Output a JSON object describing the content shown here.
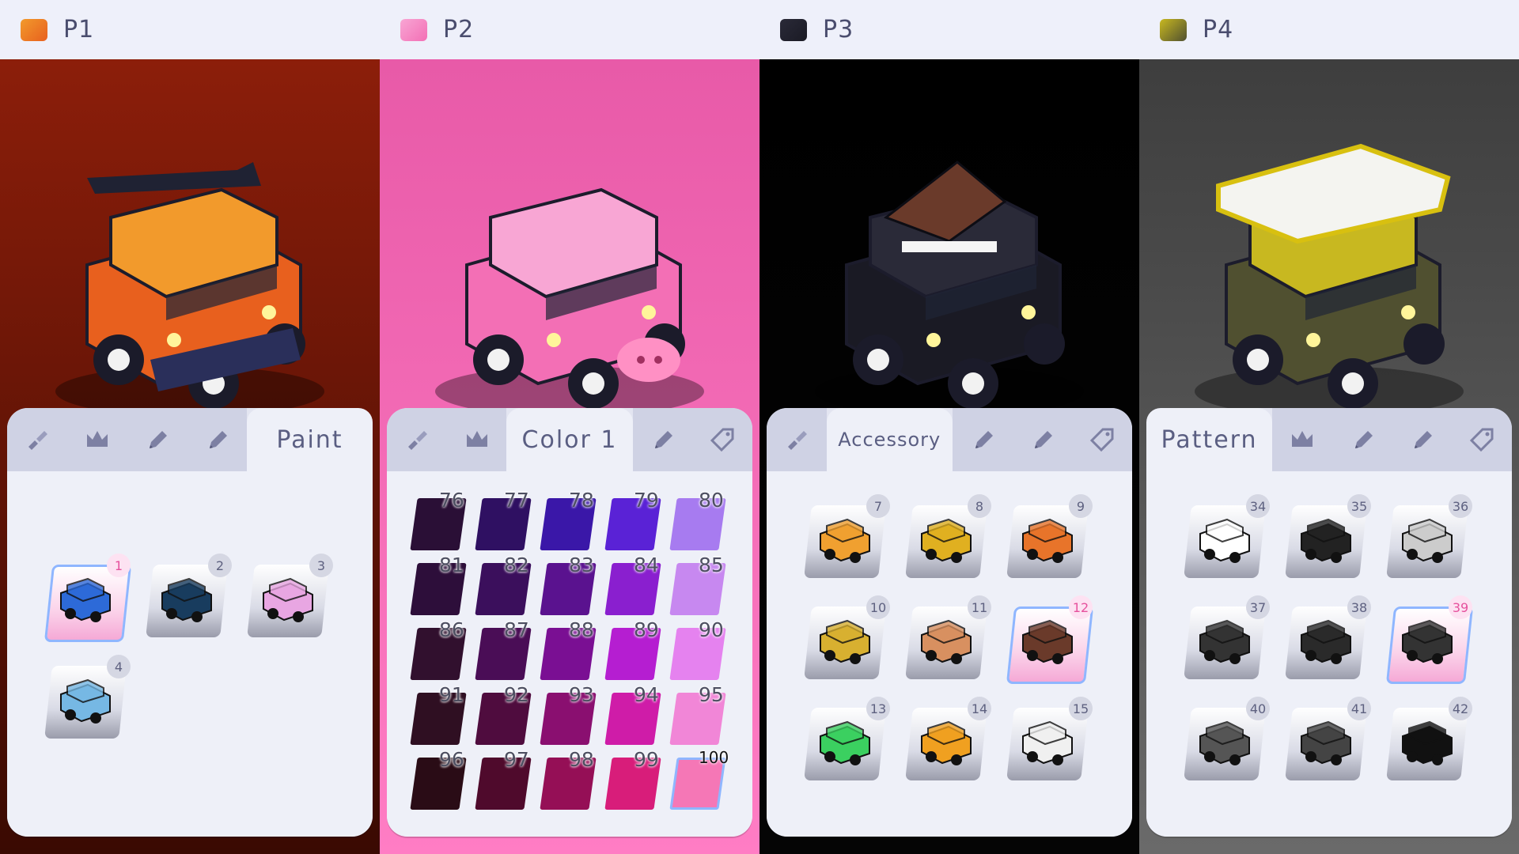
{
  "panels": [
    {
      "player": "P1",
      "bg_top": "#8c1e0a",
      "bg_bottom": "#3a0a02",
      "tabs": [
        {
          "icon": "brush-icon",
          "label": ""
        },
        {
          "icon": "crown-icon",
          "label": ""
        },
        {
          "icon": "pen-icon",
          "label": ""
        },
        {
          "icon": "pen-icon",
          "label": ""
        },
        {
          "icon": "",
          "label": "Paint",
          "active": true
        }
      ],
      "items": [
        {
          "num": "1",
          "selected": true,
          "color": "#2d6ad8"
        },
        {
          "num": "2",
          "selected": false,
          "color": "#183c5e"
        },
        {
          "num": "3",
          "selected": false,
          "color": "#e8a6e2"
        },
        {
          "num": "4",
          "selected": false,
          "color": "#76b8e4"
        }
      ]
    },
    {
      "player": "P2",
      "bg_top": "#e85aa8",
      "bg_bottom": "#ff7dc4",
      "tabs": [
        {
          "icon": "brush-icon",
          "label": ""
        },
        {
          "icon": "crown-icon",
          "label": ""
        },
        {
          "icon": "",
          "label": "Color 1",
          "active": true
        },
        {
          "icon": "pen-icon",
          "label": ""
        },
        {
          "icon": "tag-icon",
          "label": ""
        }
      ],
      "swatches": [
        {
          "num": "76",
          "color": "#2a0f36"
        },
        {
          "num": "77",
          "color": "#2f1062"
        },
        {
          "num": "78",
          "color": "#3a17a8"
        },
        {
          "num": "79",
          "color": "#5a22d6"
        },
        {
          "num": "80",
          "color": "#a77bf0"
        },
        {
          "num": "81",
          "color": "#2d0e3a"
        },
        {
          "num": "82",
          "color": "#3b0f5c"
        },
        {
          "num": "83",
          "color": "#5a128f"
        },
        {
          "num": "84",
          "color": "#8a1fcf"
        },
        {
          "num": "85",
          "color": "#c788f0"
        },
        {
          "num": "86",
          "color": "#31102e"
        },
        {
          "num": "87",
          "color": "#4a0d56"
        },
        {
          "num": "88",
          "color": "#7a0f93"
        },
        {
          "num": "89",
          "color": "#b51ed1"
        },
        {
          "num": "90",
          "color": "#e582ef"
        },
        {
          "num": "91",
          "color": "#2f0f22"
        },
        {
          "num": "92",
          "color": "#4f0c3e"
        },
        {
          "num": "93",
          "color": "#8a0f70"
        },
        {
          "num": "94",
          "color": "#cf1ca8"
        },
        {
          "num": "95",
          "color": "#f186d7"
        },
        {
          "num": "96",
          "color": "#2a0c16"
        },
        {
          "num": "97",
          "color": "#4f0a2c"
        },
        {
          "num": "98",
          "color": "#950f56"
        },
        {
          "num": "99",
          "color": "#d81d7a"
        },
        {
          "num": "100",
          "color": "#f577b6",
          "selected": true
        }
      ]
    },
    {
      "player": "P3",
      "bg_top": "#000000",
      "bg_bottom": "#050505",
      "tabs": [
        {
          "icon": "brush-icon",
          "label": ""
        },
        {
          "icon": "",
          "label": "Accessory",
          "active": true,
          "small": true
        },
        {
          "icon": "pen-icon",
          "label": ""
        },
        {
          "icon": "pen-icon",
          "label": ""
        },
        {
          "icon": "tag-icon",
          "label": ""
        }
      ],
      "items": [
        {
          "num": "7",
          "selected": false,
          "color": "#f0a030"
        },
        {
          "num": "8",
          "selected": false,
          "color": "#e0b020"
        },
        {
          "num": "9",
          "selected": false,
          "color": "#e8742a"
        },
        {
          "num": "10",
          "selected": false,
          "color": "#d8b030"
        },
        {
          "num": "11",
          "selected": false,
          "color": "#d89060"
        },
        {
          "num": "12",
          "selected": true,
          "color": "#6a3a2a"
        },
        {
          "num": "13",
          "selected": false,
          "color": "#3bd060"
        },
        {
          "num": "14",
          "selected": false,
          "color": "#f0a020"
        },
        {
          "num": "15",
          "selected": false,
          "color": "#f0f0f0"
        }
      ]
    },
    {
      "player": "P4",
      "bg_top": "#3e3e3e",
      "bg_bottom": "#6a6a6a",
      "tabs": [
        {
          "icon": "",
          "label": "Pattern",
          "active": true
        },
        {
          "icon": "crown-icon",
          "label": ""
        },
        {
          "icon": "pen-icon",
          "label": ""
        },
        {
          "icon": "pen-icon",
          "label": ""
        },
        {
          "icon": "tag-icon",
          "label": ""
        }
      ],
      "items": [
        {
          "num": "34",
          "selected": false,
          "color": "#ffffff"
        },
        {
          "num": "35",
          "selected": false,
          "color": "#222222"
        },
        {
          "num": "36",
          "selected": false,
          "color": "#cccccc"
        },
        {
          "num": "37",
          "selected": false,
          "color": "#333333"
        },
        {
          "num": "38",
          "selected": false,
          "color": "#2a2a2a"
        },
        {
          "num": "39",
          "selected": true,
          "color": "#333333"
        },
        {
          "num": "40",
          "selected": false,
          "color": "#555555"
        },
        {
          "num": "41",
          "selected": false,
          "color": "#444444"
        },
        {
          "num": "42",
          "selected": false,
          "color": "#111111"
        }
      ]
    }
  ]
}
